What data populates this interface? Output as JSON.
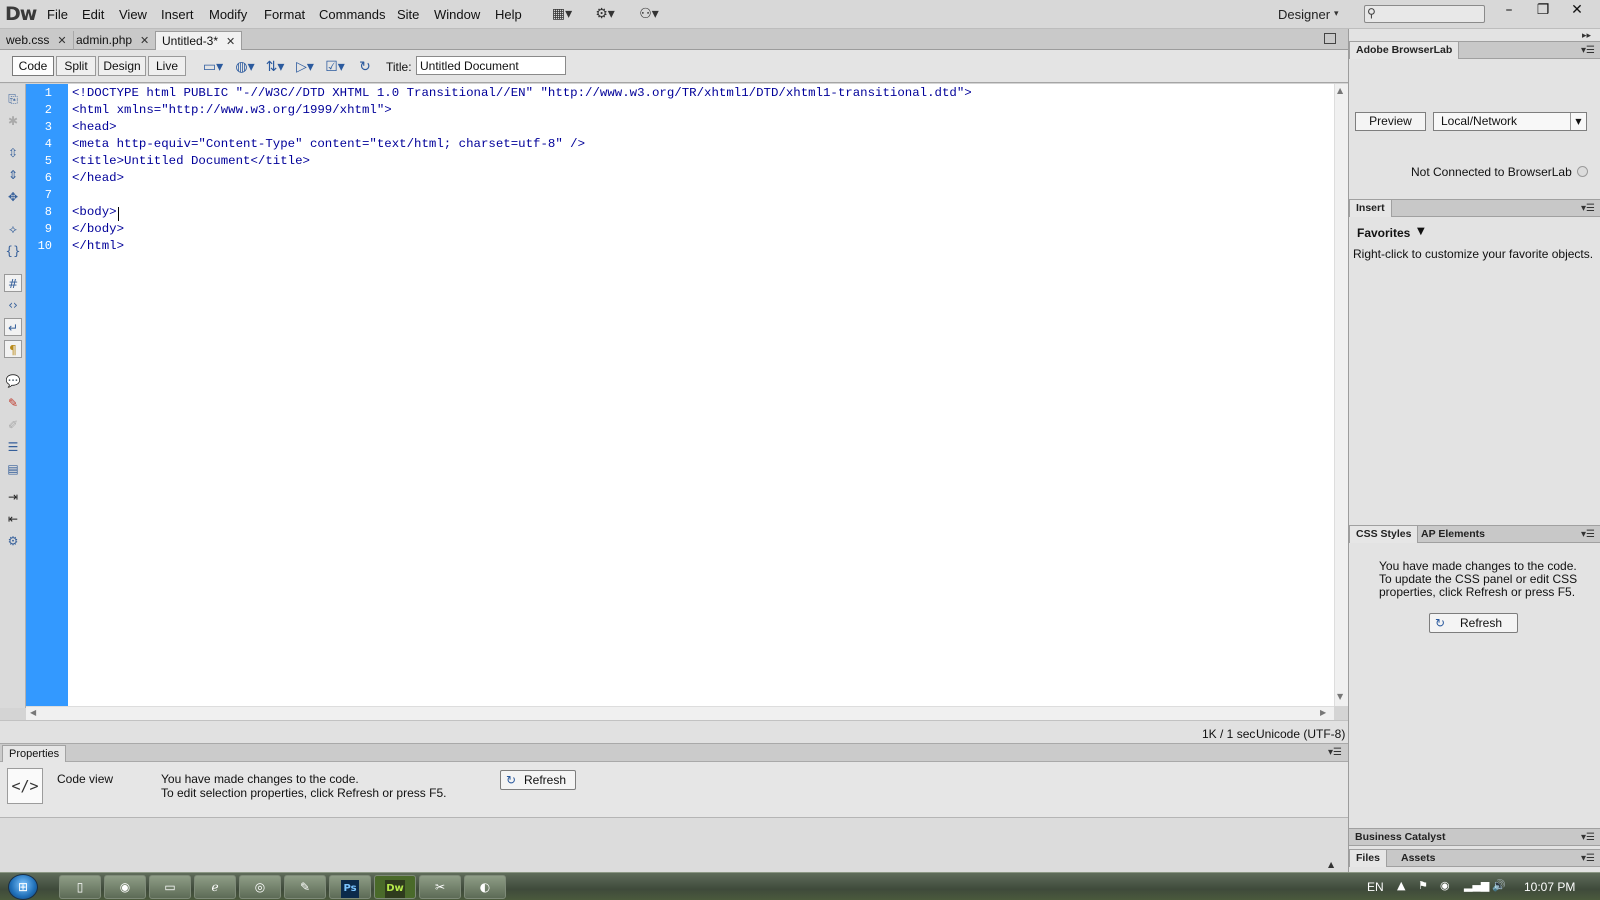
{
  "app": {
    "logo": "Dw"
  },
  "menu": [
    "File",
    "Edit",
    "View",
    "Insert",
    "Modify",
    "Format",
    "Commands",
    "Site",
    "Window",
    "Help"
  ],
  "menubar_icons": [
    "layout-icon",
    "gear-icon",
    "site-icon"
  ],
  "workspace": {
    "label": "Designer"
  },
  "window_controls": {
    "minimize": "–",
    "restore": "❐",
    "close": "✕"
  },
  "doc_tabs": [
    {
      "label": "web.css",
      "active": false
    },
    {
      "label": "admin.php",
      "active": false
    },
    {
      "label": "Untitled-3*",
      "active": true
    }
  ],
  "doc_toolbar": {
    "views": [
      "Code",
      "Split",
      "Design",
      "Live"
    ],
    "selected_view": "Code",
    "title_label": "Title:",
    "title_value": "Untitled Document"
  },
  "code": {
    "line_numbers": [
      "1",
      "2",
      "3",
      "4",
      "5",
      "6",
      "7",
      "8",
      "9",
      "10"
    ],
    "lines": [
      "<!DOCTYPE html PUBLIC \"-//W3C//DTD XHTML 1.0 Transitional//EN\" \"http://www.w3.org/TR/xhtml1/DTD/xhtml1-transitional.dtd\">",
      "<html xmlns=\"http://www.w3.org/1999/xhtml\">",
      "<head>",
      "<meta http-equiv=\"Content-Type\" content=\"text/html; charset=utf-8\" />",
      "<title>Untitled Document</title>",
      "</head>",
      "",
      "<body>",
      "</body>",
      "</html>"
    ]
  },
  "status_bar": {
    "size": "1K / 1 sec",
    "encoding": "Unicode (UTF-8)"
  },
  "properties": {
    "tab": "Properties",
    "code_view_label": "Code view",
    "message_line1": "You have made changes to the code.",
    "message_line2": "To edit selection properties, click Refresh or press F5.",
    "refresh_label": "Refresh"
  },
  "right_panels": {
    "browserlab": {
      "tab": "Adobe BrowserLab",
      "preview_label": "Preview",
      "select_value": "Local/Network",
      "status": "Not Connected to BrowserLab"
    },
    "insert": {
      "tab": "Insert",
      "category": "Favorites",
      "hint": "Right-click to customize your favorite objects."
    },
    "css": {
      "tabs": [
        "CSS Styles",
        "AP Elements"
      ],
      "message_lines": [
        "You have made changes to the code.",
        "To update the CSS panel or edit CSS",
        "properties, click Refresh or press F5."
      ],
      "refresh_label": "Refresh"
    },
    "business_catalyst": {
      "tab": "Business Catalyst"
    },
    "files": {
      "tabs": [
        "Files",
        "Assets"
      ]
    }
  },
  "taskbar": {
    "apps": [
      "folder-app",
      "firefox-app",
      "explorer-app",
      "ie-app",
      "chrome-app",
      "paint-app",
      "photoshop-app",
      "dreamweaver-app",
      "snip-app",
      "media-app"
    ],
    "photoshop_label": "Ps",
    "dreamweaver_label": "Dw",
    "language": "EN",
    "clock": "10:07 PM"
  }
}
